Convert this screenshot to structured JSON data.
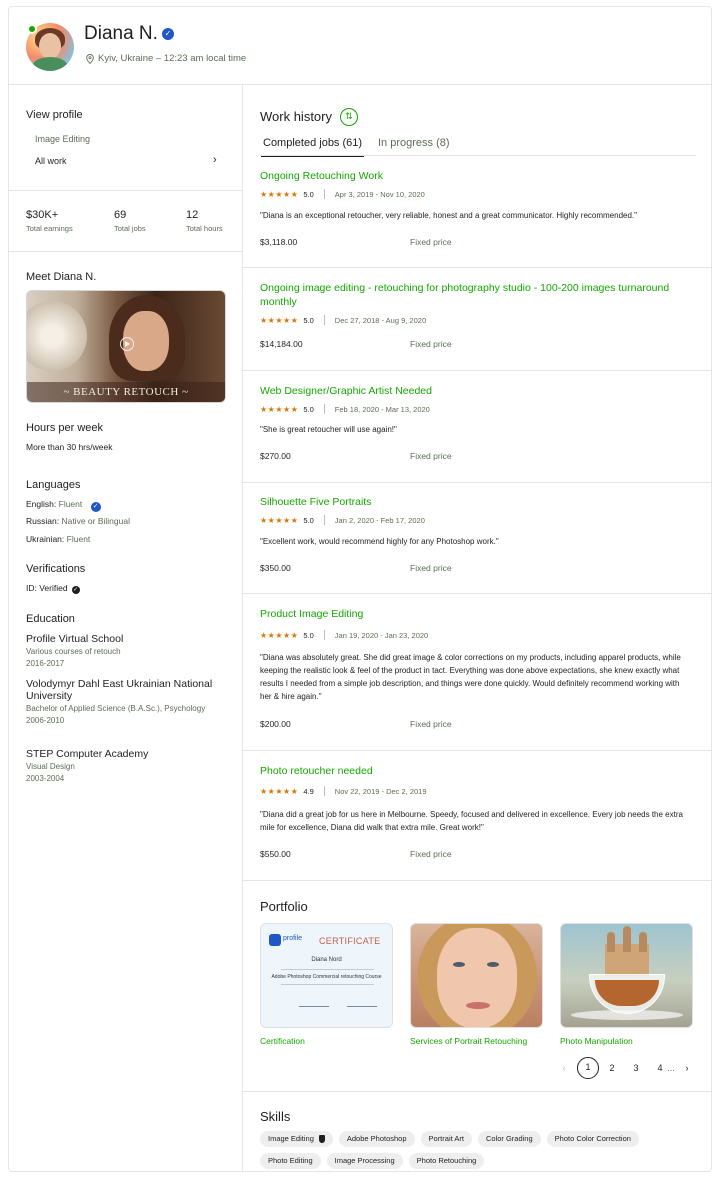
{
  "profile": {
    "name": "Diana N.",
    "location": "Kyiv, Ukraine – 12:23 am local time"
  },
  "sidebar": {
    "view_profile": "View profile",
    "items": [
      {
        "label": "Image Editing"
      },
      {
        "label": "All work"
      }
    ],
    "stats": [
      {
        "value": "$30K+",
        "label": "Total earnings"
      },
      {
        "value": "69",
        "label": "Total jobs"
      },
      {
        "value": "12",
        "label": "Total hours"
      }
    ],
    "meet_title": "Meet Diana N.",
    "video_banner": "~ BEAUTY RETOUCH ~",
    "hours_title": "Hours per week",
    "hours_value": "More than 30 hrs/week",
    "languages_title": "Languages",
    "languages": [
      {
        "name": "English:",
        "level": "Fluent"
      },
      {
        "name": "Russian:",
        "level": "Native or Bilingual"
      },
      {
        "name": "Ukrainian:",
        "level": "Fluent"
      }
    ],
    "verifications_title": "Verifications",
    "verification_value": "ID: Verified",
    "education_title": "Education",
    "education": [
      {
        "school": "Profile Virtual School",
        "degree": "Various courses of retouch",
        "years": "2016-2017"
      },
      {
        "school": "Volodymyr Dahl East Ukrainian National University",
        "degree": "Bachelor of Applied Science (B.A.Sc.), Psychology",
        "years": "2006-2010"
      },
      {
        "school": "STEP Computer Academy",
        "degree": "Visual Design",
        "years": "2003-2004"
      }
    ]
  },
  "work_history": {
    "title": "Work history",
    "tabs": [
      {
        "label": "Completed jobs (61)"
      },
      {
        "label": "In progress (8)"
      }
    ],
    "stars": "★★★★★",
    "jobs": [
      {
        "title": "Ongoing Retouching Work",
        "rating": "5.0",
        "dates": "Apr 3, 2019 - Nov 10, 2020",
        "feedback": "\"Diana is an exceptional retoucher, very reliable, honest and a great communicator. Highly recommended.\"",
        "amount": "$3,118.00",
        "type": "Fixed price"
      },
      {
        "title": "Ongoing image editing - retouching for photography studio - 100-200 images turnaround monthly",
        "rating": "5.0",
        "dates": "Dec 27, 2018 - Aug 9, 2020",
        "feedback": "",
        "amount": "$14,184.00",
        "type": "Fixed price"
      },
      {
        "title": "Web Designer/Graphic Artist Needed",
        "rating": "5.0",
        "dates": "Feb 18, 2020 - Mar 13, 2020",
        "feedback": "\"She is great retoucher will use again!\"",
        "amount": "$270.00",
        "type": "Fixed price"
      },
      {
        "title": "Silhouette Five Portraits",
        "rating": "5.0",
        "dates": "Jan 2, 2020 - Feb 17, 2020",
        "feedback": "\"Excellent work, would recommend highly for any Photoshop work.\"",
        "amount": "$350.00",
        "type": "Fixed price"
      },
      {
        "title": "Product Image Editing",
        "rating": "5.0",
        "dates": "Jan 19, 2020 - Jan 23, 2020",
        "feedback": "\"Diana was absolutely great. She did great image & color corrections on my products, including apparel products, while keeping the realistic look & feel of the product in tact. Everything was done above expectations, she knew exactly what results I needed from a simple job description, and things were done quickly. Would definitely recommend working with her & hire again.\"",
        "amount": "$200.00",
        "type": "Fixed price"
      },
      {
        "title": "Photo retoucher needed",
        "rating": "4.9",
        "dates": "Nov 22, 2019 - Dec 2, 2019",
        "feedback": "\"Diana did a great job for us here in Melbourne. Speedy, focused and delivered in excellence. Every job needs the extra mile for excellence, Diana did walk that extra mile. Great work!\"",
        "amount": "$550.00",
        "type": "Fixed price"
      }
    ]
  },
  "portfolio": {
    "title": "Portfolio",
    "items": [
      {
        "caption": "Certification",
        "cert_brand": "profile",
        "cert_title": "CERTIFICATE",
        "cert_name": "Diana Nord",
        "cert_course": "Adobe Photoshop Commercial retouching Course"
      },
      {
        "caption": "Services of Portrait Retouching"
      },
      {
        "caption": "Photo Manipulation"
      }
    ],
    "pager": {
      "prev": "‹",
      "pages": [
        "1",
        "2",
        "3",
        "4"
      ],
      "ellipsis": "...",
      "next": "›",
      "current": "1"
    }
  },
  "skills": {
    "title": "Skills",
    "items": [
      "Image Editing",
      "Adobe Photoshop",
      "Portrait Art",
      "Color Grading",
      "Photo Color Correction",
      "Photo Editing",
      "Image Processing",
      "Photo Retouching"
    ]
  },
  "colors": {
    "accent_green": "#14a800",
    "verified_blue": "#1f57c3",
    "star_orange": "#d97706"
  },
  "icons": [
    "map-pin-icon",
    "verified-badge-icon",
    "chevron-right-icon",
    "play-icon",
    "sort-icon",
    "star-icon",
    "badge-icon"
  ]
}
